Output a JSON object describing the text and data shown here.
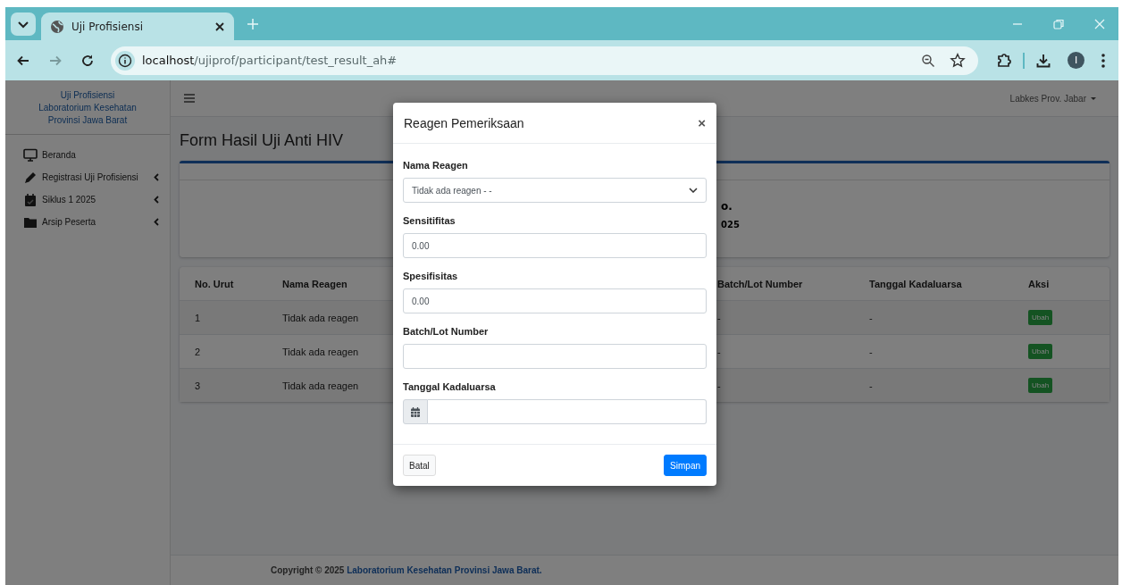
{
  "browser": {
    "tabs": [
      {
        "title": "Uji Profisiensi",
        "selected": true
      }
    ],
    "url_host": "localhost",
    "url_path": "/ujiprof/participant/test_result_ah#",
    "avatar": "I"
  },
  "sidebar": {
    "brand": [
      "Uji Profisiensi",
      "Laboratorium Kesehatan",
      "Provinsi Jawa Barat"
    ],
    "items": [
      {
        "label": "Beranda",
        "kind": "monitor",
        "expandable": false
      },
      {
        "label": "Registrasi Uji Profisiensi",
        "kind": "pen",
        "expandable": true
      },
      {
        "label": "Siklus 1 2025",
        "kind": "calendar",
        "expandable": true
      },
      {
        "label": "Arsip Peserta",
        "kind": "folder",
        "expandable": true
      }
    ]
  },
  "navbar": {
    "user": "Labkes Prov. Jabar"
  },
  "page_title": "Form Hasil Uji Anti HIV",
  "info_fragments": [
    "o.",
    "025"
  ],
  "table": {
    "columns": [
      "No. Urut",
      "Nama Reagen",
      "Batch/Lot Number",
      "Tanggal Kadaluarsa",
      "Aksi"
    ],
    "rows": [
      {
        "cells": [
          "1",
          "Tidak ada reagen",
          "-",
          "-"
        ],
        "action": "Ubah"
      },
      {
        "cells": [
          "2",
          "Tidak ada reagen",
          "-",
          "-"
        ],
        "action": "Ubah"
      },
      {
        "cells": [
          "3",
          "Tidak ada reagen",
          "-",
          "-"
        ],
        "action": "Ubah"
      }
    ]
  },
  "modal": {
    "title": "Reagen Pemeriksaan",
    "close": "×",
    "fields": [
      {
        "label": "Nama Reagen",
        "kind": "select",
        "value": "Tidak ada reagen - -"
      },
      {
        "label": "Sensitifitas",
        "kind": "text",
        "value": "0.00"
      },
      {
        "label": "Spesifisitas",
        "kind": "text",
        "value": "0.00"
      },
      {
        "label": "Batch/Lot Number",
        "kind": "text"
      },
      {
        "label": "Tanggal Kadaluarsa",
        "kind": "date"
      }
    ],
    "cancel": "Batal",
    "save": "Simpan"
  },
  "footer": {
    "text": "Copyright © 2025",
    "link": "Laboratorium Kesehatan Provinsi Jawa Barat."
  }
}
